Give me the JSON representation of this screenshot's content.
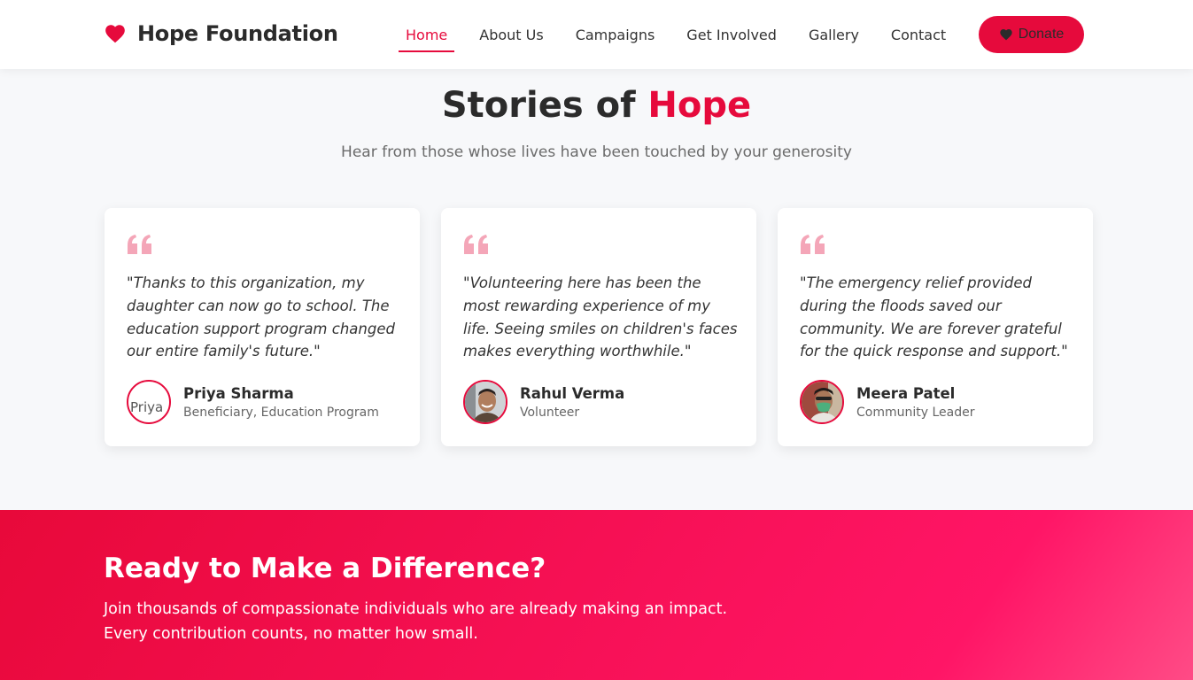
{
  "brand": {
    "name": "Hope Foundation",
    "icon": "heart-icon",
    "color": "#e60a3c"
  },
  "nav": {
    "items": [
      {
        "label": "Home",
        "active": true
      },
      {
        "label": "About Us",
        "active": false
      },
      {
        "label": "Campaigns",
        "active": false
      },
      {
        "label": "Get Involved",
        "active": false
      },
      {
        "label": "Gallery",
        "active": false
      },
      {
        "label": "Contact",
        "active": false
      }
    ],
    "donate_label": "Donate"
  },
  "testimonials": {
    "title_main": "Stories of",
    "title_accent": "Hope",
    "subtitle": "Hear from those whose lives have been touched by your generosity",
    "cards": [
      {
        "quote": "\"Thanks to this organization, my daughter can now go to school. The education support program changed our entire family's future.\"",
        "name": "Priya Sharma",
        "role": "Beneficiary, Education Program",
        "avatar_alt": "Priya"
      },
      {
        "quote": "\"Volunteering here has been the most rewarding experience of my life. Seeing smiles on children's faces makes everything worthwhile.\"",
        "name": "Rahul Verma",
        "role": "Volunteer"
      },
      {
        "quote": "\"The emergency relief provided during the floods saved our community. We are forever grateful for the quick response and support.\"",
        "name": "Meera Patel",
        "role": "Community Leader"
      }
    ]
  },
  "cta": {
    "title": "Ready to Make a Difference?",
    "text_line1": "Join thousands of compassionate individuals who are already making an impact.",
    "text_line2": "Every contribution counts, no matter how small."
  },
  "colors": {
    "accent": "#e60a3c",
    "quote_icon": "#f4a6b8",
    "background": "#f7f8fa"
  }
}
